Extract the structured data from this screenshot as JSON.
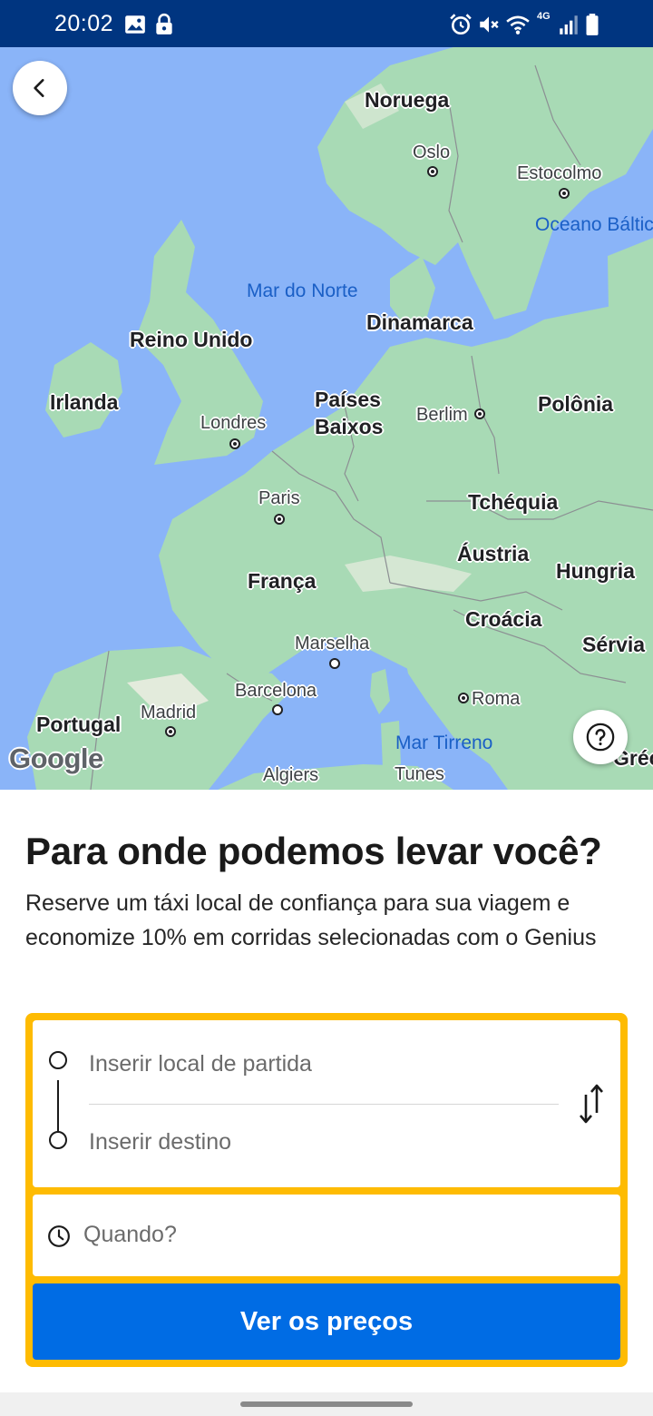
{
  "status_bar": {
    "time": "20:02",
    "network": "4G",
    "icons": [
      "image-icon",
      "lock-icon",
      "alarm-icon",
      "mute-icon",
      "wifi-icon",
      "signal-icon",
      "battery-icon"
    ],
    "background_color": "#003580"
  },
  "map": {
    "countries": [
      "Noruega",
      "Dinamarca",
      "Reino Unido",
      "Irlanda",
      "Países",
      "Baixos",
      "Polônia",
      "Tchéquia",
      "Áustria",
      "Hungria",
      "França",
      "Croácia",
      "Sérvia",
      "Portugal",
      "Gréc"
    ],
    "cities": [
      "Oslo",
      "Estocolmo",
      "Londres",
      "Berlim",
      "Paris",
      "Marselha",
      "Barcelona",
      "Roma",
      "Madrid",
      "Algiers",
      "Tunes"
    ],
    "waters": [
      "Mar do Norte",
      "Oceano Báltico",
      "Mar Tirreno"
    ],
    "attribution": "Google",
    "back_button": "chevron-left-icon",
    "help_button": "help-icon"
  },
  "sheet": {
    "title": "Para onde podemos levar você?",
    "subtitle": "Reserve um táxi local de confiança para sua viagem e economize 10% em corridas selecionadas com o Genius"
  },
  "form": {
    "pickup_placeholder": "Inserir local de partida",
    "destination_placeholder": "Inserir destino",
    "when_placeholder": "Quando?",
    "submit_label": "Ver os preços",
    "border_color": "#febb02",
    "button_color": "#006ce4"
  }
}
